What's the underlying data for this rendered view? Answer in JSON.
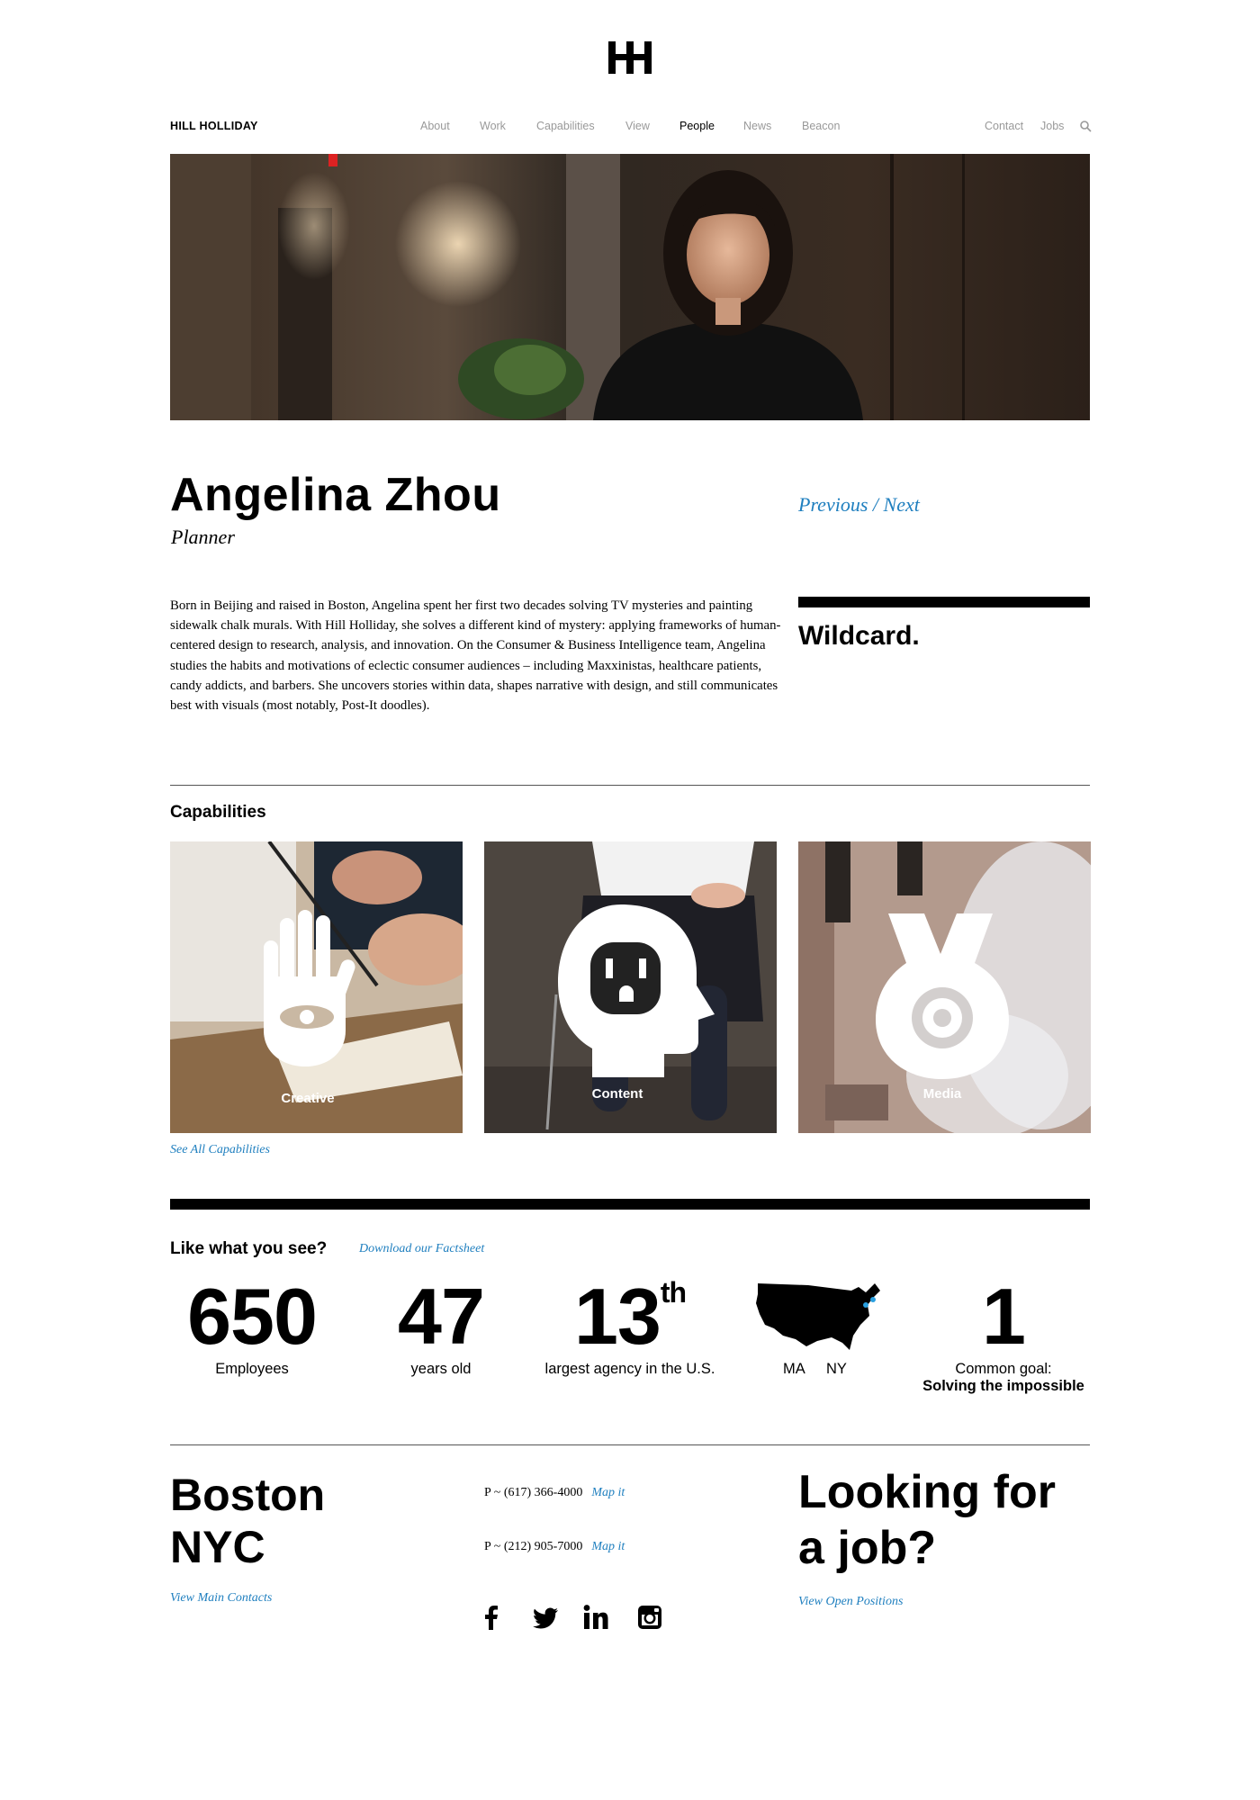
{
  "header": {
    "brand": "HILL HOLLIDAY",
    "nav": [
      "About",
      "Work",
      "Capabilities",
      "View",
      "People",
      "News",
      "Beacon"
    ],
    "active_nav": "People",
    "utility_nav": [
      "Contact",
      "Jobs"
    ]
  },
  "profile": {
    "name": "Angelina Zhou",
    "title": "Planner",
    "bio": "Born in Beijing and raised in Boston, Angelina spent her first two decades solving TV mysteries and painting sidewalk chalk murals. With Hill Holliday, she solves a different kind of mystery: applying frameworks of human-centered design to research, analysis, and innovation. On the Consumer & Business Intelligence team, Angelina studies the habits and motivations of eclectic consumer audiences – including Maxxinistas, healthcare patients, candy addicts, and barbers. She uncovers stories within data, shapes narrative with design, and still communicates best with visuals (most notably, Post-It doodles).",
    "previous_label": "Previous",
    "separator": "/",
    "next_label": "Next",
    "tag": "Wildcard."
  },
  "capabilities": {
    "heading": "Capabilities",
    "tiles": [
      {
        "label": "Creative",
        "icon": "hand-eye-icon"
      },
      {
        "label": "Content",
        "icon": "outlet-head-icon"
      },
      {
        "label": "Media",
        "icon": "target-vase-icon"
      }
    ],
    "see_all": "See All Capabilities"
  },
  "stats": {
    "heading": "Like what you see?",
    "factsheet": "Download our Factsheet",
    "employees": {
      "num": "650",
      "label": "Employees"
    },
    "age": {
      "num": "47",
      "label": "years old"
    },
    "rank": {
      "num": "13",
      "sup": "th",
      "label": "largest agency in the U.S."
    },
    "map": {
      "ma": "MA",
      "ny": "NY"
    },
    "goal": {
      "num": "1",
      "label": "Common goal:",
      "bold": "Solving the impossible"
    }
  },
  "footer": {
    "city1": "Boston",
    "city2": "NYC",
    "contacts": "View Main Contacts",
    "phone_boston": "P ~ (617) 366-4000",
    "phone_nyc": "P ~ (212) 905-7000",
    "map_it": "Map it",
    "job_line1": "Looking for",
    "job_line2": "a job?",
    "positions": "View Open Positions"
  },
  "colors": {
    "link": "#1f7fbf",
    "text": "#000000",
    "nav_inactive": "#999999"
  }
}
